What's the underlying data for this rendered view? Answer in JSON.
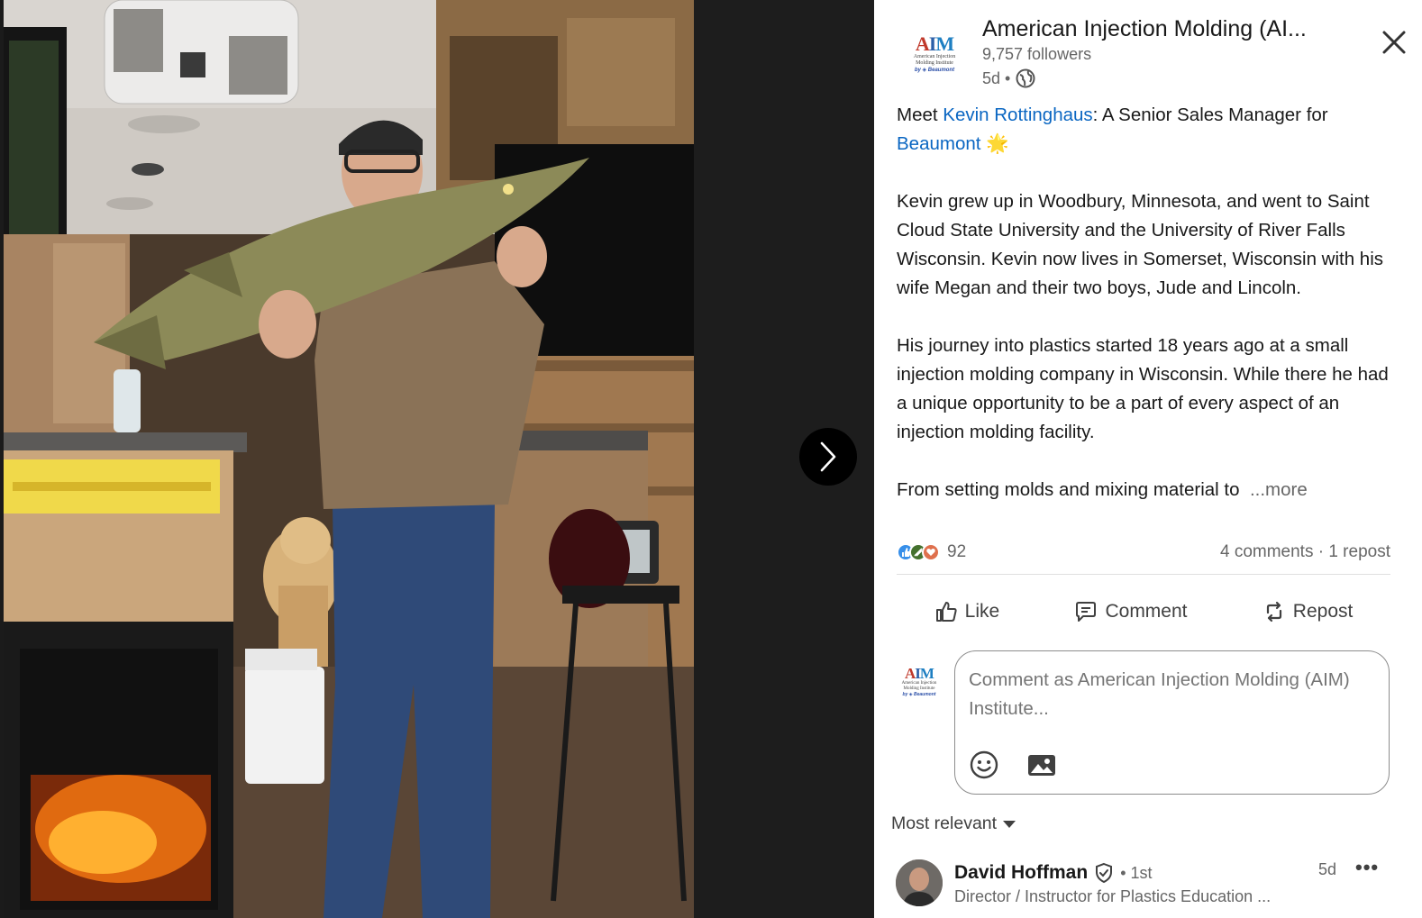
{
  "viewer": {
    "next_icon": "chevron-right-icon",
    "photo_alt": "Man holding a large northern pike fish inside an ice house"
  },
  "post": {
    "org_name": "American Injection Molding (AI...",
    "followers": "9,757 followers",
    "time": "5d •",
    "visibility_icon": "globe-icon",
    "close_icon": "close-icon",
    "logo": {
      "letters": [
        "A",
        "I",
        "M"
      ],
      "subtitle_line1": "American Injection",
      "subtitle_line2": "Molding Institute",
      "brand": "by ◈ Beaumont"
    },
    "headline_prefix": "Meet ",
    "headline_link_person": "Kevin Rottinghaus",
    "headline_middle": ": A Senior Sales Manager for ",
    "headline_link_company": "Beaumont",
    "headline_emoji": "🌟",
    "paragraph_1": "Kevin grew up in Woodbury, Minnesota, and went to Saint Cloud State University and the University of River Falls Wisconsin. Kevin now lives in Somerset, Wisconsin with his wife Megan and their two boys, Jude and Lincoln.",
    "paragraph_2": "His journey into plastics started 18 years ago at a small injection molding company in Wisconsin. While there he had a unique opportunity to be a part of every aspect of an injection molding facility.",
    "paragraph_3": "From setting molds and mixing material to",
    "more_label": "...more"
  },
  "social": {
    "reaction_count": "92",
    "comments_reposts": "4 comments · 1 repost",
    "reaction_colors": [
      "#378fe9",
      "#44712e",
      "#df704d"
    ]
  },
  "actions": {
    "like": "Like",
    "comment": "Comment",
    "repost": "Repost"
  },
  "comment_box": {
    "placeholder": "Comment as American Injection Molding (AIM) Institute..."
  },
  "sort": {
    "label": "Most relevant"
  },
  "comment": {
    "name": "David Hoffman",
    "degree": "• 1st",
    "title": "Director / Instructor for Plastics Education ...",
    "time": "5d",
    "menu": "•••"
  },
  "colors": {
    "link": "#0a66c2",
    "text": "#191919",
    "muted": "#666666"
  }
}
